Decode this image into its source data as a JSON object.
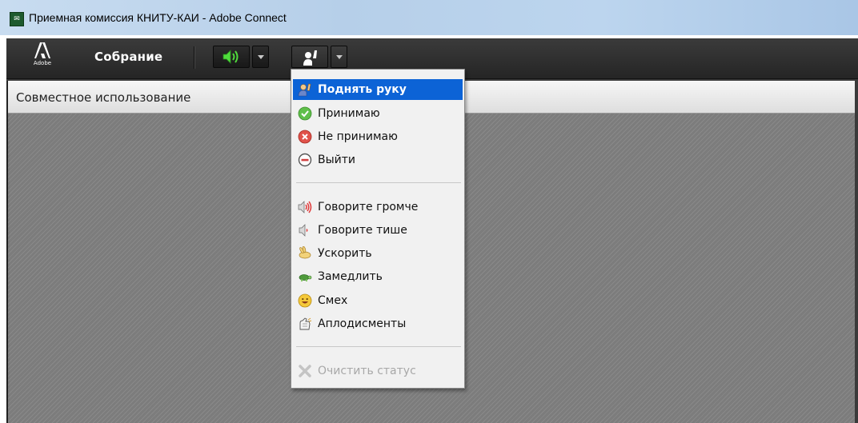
{
  "window": {
    "title": "Приемная комиссия КНИТУ-КАИ - Adobe Connect",
    "icon": "adobe-connect-app-icon"
  },
  "toolbar": {
    "logo_text": "Adobe",
    "meeting_menu": "Собрание",
    "audio_button_icon": "speaker-on-icon",
    "status_button_icon": "raise-hand-icon"
  },
  "pod": {
    "title": "Совместное использование"
  },
  "status_menu": {
    "items": [
      {
        "label": "Поднять руку",
        "icon": "raise-hand-icon",
        "selected": true
      },
      {
        "label": "Принимаю",
        "icon": "agree-check-icon"
      },
      {
        "label": "Не принимаю",
        "icon": "disagree-x-icon"
      },
      {
        "label": "Выйти",
        "icon": "step-away-minus-icon"
      },
      {
        "label": "Говорите громче",
        "icon": "speak-louder-icon"
      },
      {
        "label": "Говорите тише",
        "icon": "speak-softer-icon"
      },
      {
        "label": "Ускорить",
        "icon": "speed-up-rabbit-icon"
      },
      {
        "label": "Замедлить",
        "icon": "slow-down-turtle-icon"
      },
      {
        "label": "Смех",
        "icon": "laugh-smiley-icon"
      },
      {
        "label": "Аплодисменты",
        "icon": "applause-hands-icon"
      },
      {
        "label": "Очистить статус",
        "icon": "clear-status-x-icon",
        "disabled": true
      }
    ]
  },
  "colors": {
    "toolbar_bg": "#2e2e2e",
    "menu_highlight": "#0c63d6",
    "audio_green": "#3cc93c"
  }
}
